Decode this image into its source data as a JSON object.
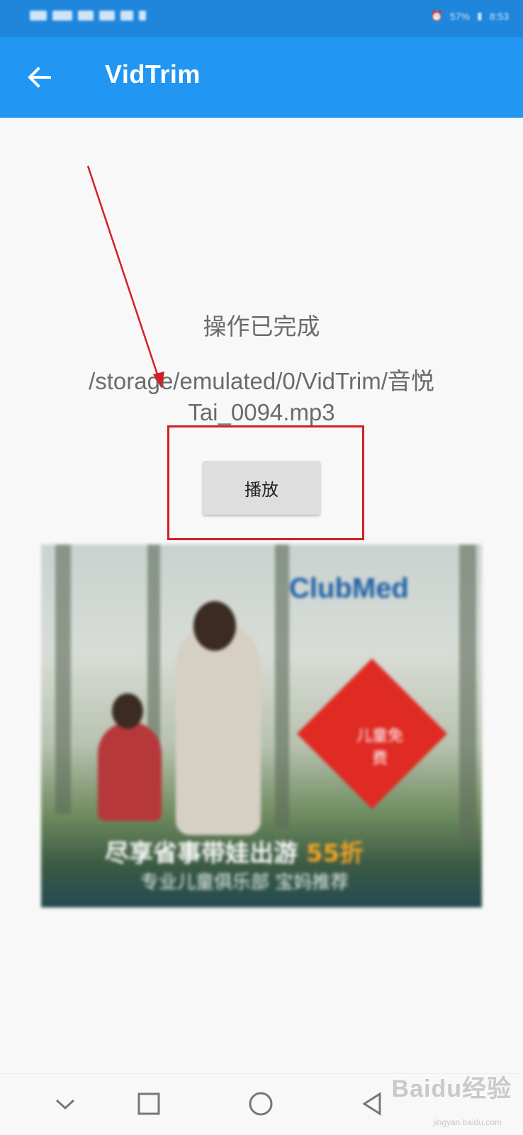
{
  "status_bar": {
    "battery": "57%",
    "time": "8:53"
  },
  "app_bar": {
    "title": "VidTrim",
    "back_icon": "arrow-left-icon"
  },
  "main": {
    "status_message": "操作已完成",
    "output_path": "/storage/emulated/0/VidTrim/音悦Tai_0094.mp3",
    "play_label": "播放"
  },
  "ad": {
    "logo": "ClubMed",
    "badge": "儿童免费",
    "headline_prefix": "尽享省事带娃出游",
    "headline_accent": "55折",
    "subline": "专业儿童俱乐部 宝妈推荐"
  },
  "nav_bar": {
    "icons": [
      "chevron-down-icon",
      "square-icon",
      "circle-icon",
      "triangle-back-icon"
    ]
  },
  "watermark": {
    "brand": "Baidu经验",
    "url": "jingyan.baidu.com"
  },
  "colors": {
    "app_bar": "#2196f3",
    "status_bar": "#1f86dc",
    "annotation_red": "#d11f26"
  }
}
